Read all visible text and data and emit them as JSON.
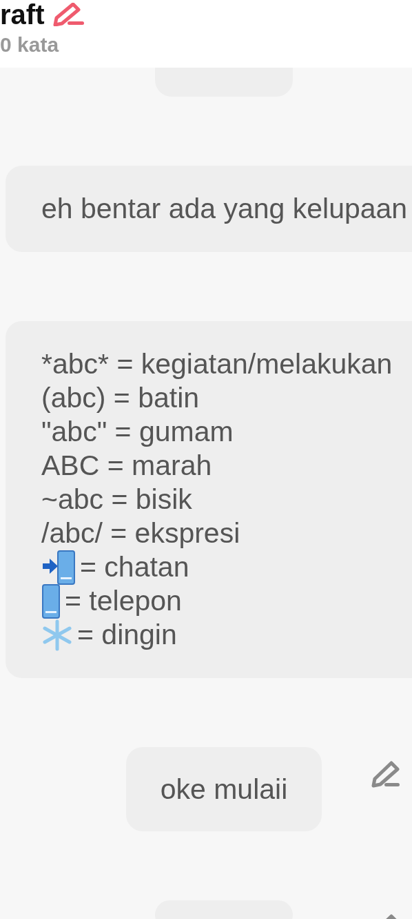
{
  "header": {
    "title": "raft",
    "word_count": "0 kata"
  },
  "messages": [
    {
      "kind": "sent",
      "editable": false
    },
    {
      "kind": "received",
      "editable": false,
      "lines": [
        {
          "kind": "text",
          "text": "eh bentar ada yang kelupaan"
        }
      ]
    },
    {
      "kind": "received",
      "editable": false,
      "lines": [
        {
          "kind": "text",
          "text": "*abc* = kegiatan/melakukan"
        },
        {
          "kind": "text",
          "text": "(abc) = batin"
        },
        {
          "kind": "text",
          "text": "\"abc\" = gumam"
        },
        {
          "kind": "text",
          "text": "ABC = marah"
        },
        {
          "kind": "text",
          "text": "~abc = bisik"
        },
        {
          "kind": "text",
          "text": "/abc/ = ekspresi"
        },
        {
          "kind": "arrow-phone",
          "text": "= chatan"
        },
        {
          "kind": "phone",
          "text": "= telepon"
        },
        {
          "kind": "snowflake",
          "text": "= dingin"
        }
      ]
    },
    {
      "kind": "sent",
      "editable": true,
      "lines": [
        {
          "kind": "text",
          "text": "oke mulaii"
        }
      ]
    },
    {
      "kind": "sent",
      "editable": true
    }
  ]
}
